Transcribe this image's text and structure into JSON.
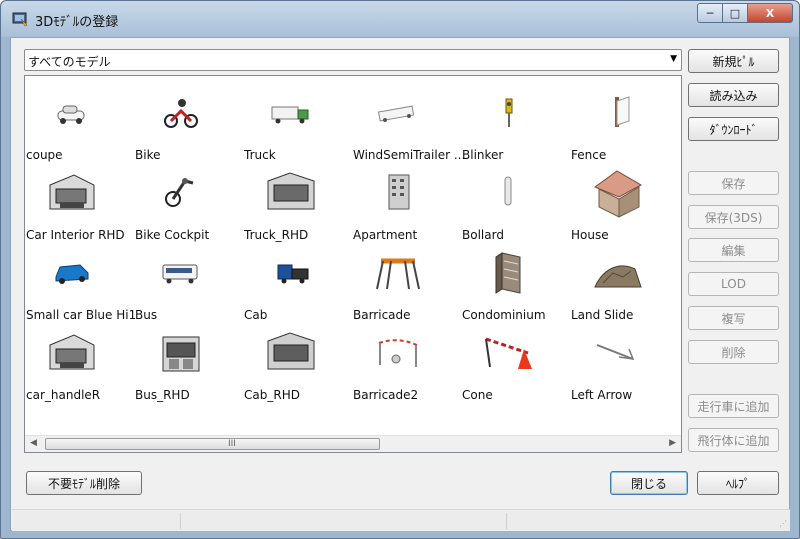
{
  "window": {
    "title": "3Dﾓﾃﾞﾙの登録",
    "minimize": "─",
    "maximize": "□",
    "close": "X"
  },
  "filter": {
    "value": "すべてのモデル"
  },
  "models": [
    {
      "label": "coupe",
      "icon": "coupe-icon"
    },
    {
      "label": "Bike",
      "icon": "bike-icon"
    },
    {
      "label": "Truck",
      "icon": "truck-icon"
    },
    {
      "label": "WindSemiTrailer ...",
      "icon": "semitrailer-icon"
    },
    {
      "label": "Blinker",
      "icon": "blinker-icon"
    },
    {
      "label": "Fence",
      "icon": "fence-icon"
    },
    {
      "label": "Car Interior RHD",
      "icon": "car-interior-icon"
    },
    {
      "label": "Bike Cockpit",
      "icon": "bike-cockpit-icon"
    },
    {
      "label": "Truck_RHD",
      "icon": "truck-interior-icon"
    },
    {
      "label": "Apartment",
      "icon": "apartment-icon"
    },
    {
      "label": "Bollard",
      "icon": "bollard-icon"
    },
    {
      "label": "House",
      "icon": "house-icon"
    },
    {
      "label": "Small car Blue Hi1",
      "icon": "small-car-icon"
    },
    {
      "label": "Bus",
      "icon": "bus-icon"
    },
    {
      "label": "Cab",
      "icon": "cab-icon"
    },
    {
      "label": "Barricade",
      "icon": "barricade-icon"
    },
    {
      "label": "Condominium",
      "icon": "condominium-icon"
    },
    {
      "label": "Land Slide",
      "icon": "landslide-icon"
    },
    {
      "label": "car_handleR",
      "icon": "car-interior-icon"
    },
    {
      "label": "Bus_RHD",
      "icon": "bus-interior-icon"
    },
    {
      "label": "Cab_RHD",
      "icon": "cab-interior-icon"
    },
    {
      "label": "Barricade2",
      "icon": "barricade2-icon"
    },
    {
      "label": "Cone",
      "icon": "cone-icon"
    },
    {
      "label": "Left Arrow",
      "icon": "left-arrow-icon"
    }
  ],
  "scrollbar": {
    "grip": "III"
  },
  "buttons": {
    "new": "新規ﾋﾟﾙ",
    "import": "読み込み",
    "download": "ﾀﾞｳﾝﾛｰﾄﾞ",
    "save": "保存",
    "save3ds": "保存(3DS)",
    "edit": "編集",
    "lod": "LOD",
    "copy": "複写",
    "delete": "削除",
    "add_vehicle": "走行車に追加",
    "add_aircraft": "飛行体に追加",
    "remove_unused": "不要ﾓﾃﾞﾙ削除",
    "close": "閉じる",
    "help": "ﾍﾙﾌﾟ"
  }
}
